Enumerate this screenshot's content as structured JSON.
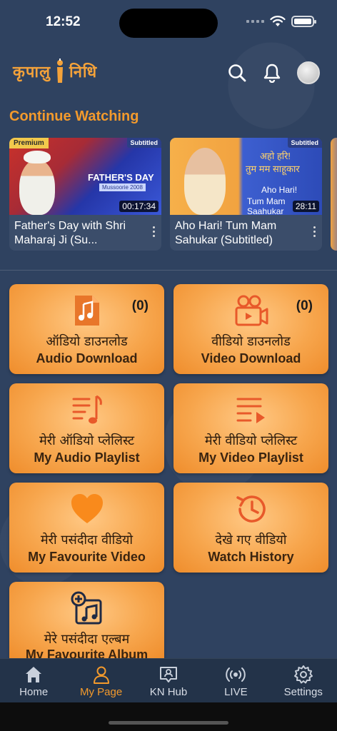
{
  "status": {
    "time": "12:52"
  },
  "header": {
    "logo_text_1": "कृपालु",
    "logo_text_2": "निधि"
  },
  "continue_watching": {
    "title": "Continue Watching",
    "items": [
      {
        "badge": "Premium",
        "tag": "Subtitled",
        "thumb_caption": "FATHER'S DAY",
        "thumb_sub": "Mussoorie 2008",
        "duration": "00:17:34",
        "title": "Father's Day with Shri Maharaj Ji (Su..."
      },
      {
        "tag": "Subtitled",
        "thumb_hi_1": "अहो हरि!",
        "thumb_hi_2": "तुम मम साहूकार",
        "thumb_en_1": "Aho Hari!",
        "thumb_en_2": "Tum Mam Saahukar",
        "duration": "28:11",
        "title": "Aho Hari! Tum Mam Sahukar (Subtitled)"
      }
    ]
  },
  "tiles": [
    {
      "hi": "ऑडियो डाउनलोड",
      "en": "Audio Download",
      "count": "(0)",
      "icon": "music-file-icon"
    },
    {
      "hi": "वीडियो डाउनलोड",
      "en": "Video Download",
      "count": "(0)",
      "icon": "video-camera-icon"
    },
    {
      "hi": "मेरी ऑडियो प्लेलिस्ट",
      "en": "My Audio Playlist",
      "icon": "audio-playlist-icon"
    },
    {
      "hi": "मेरी वीडियो प्लेलिस्ट",
      "en": "My Video Playlist",
      "icon": "video-playlist-icon"
    },
    {
      "hi": "मेरी पसंदीदा वीडियो",
      "en": "My Favourite Video",
      "icon": "heart-icon"
    },
    {
      "hi": "देखे गए वीडियो",
      "en": "Watch History",
      "icon": "history-icon"
    },
    {
      "hi": "मेरे पसंदीदा एल्बम",
      "en": "My Favourite Album",
      "icon": "album-add-icon"
    }
  ],
  "nav": {
    "items": [
      {
        "label": "Home",
        "icon": "home-icon"
      },
      {
        "label": "My Page",
        "icon": "user-icon",
        "active": true
      },
      {
        "label": "KN Hub",
        "icon": "chat-user-icon"
      },
      {
        "label": "LIVE",
        "icon": "live-broadcast-icon"
      },
      {
        "label": "Settings",
        "icon": "gear-icon"
      }
    ]
  },
  "colors": {
    "accent": "#f39a2c",
    "background": "#2f4260",
    "tile": "#f7a64d"
  }
}
